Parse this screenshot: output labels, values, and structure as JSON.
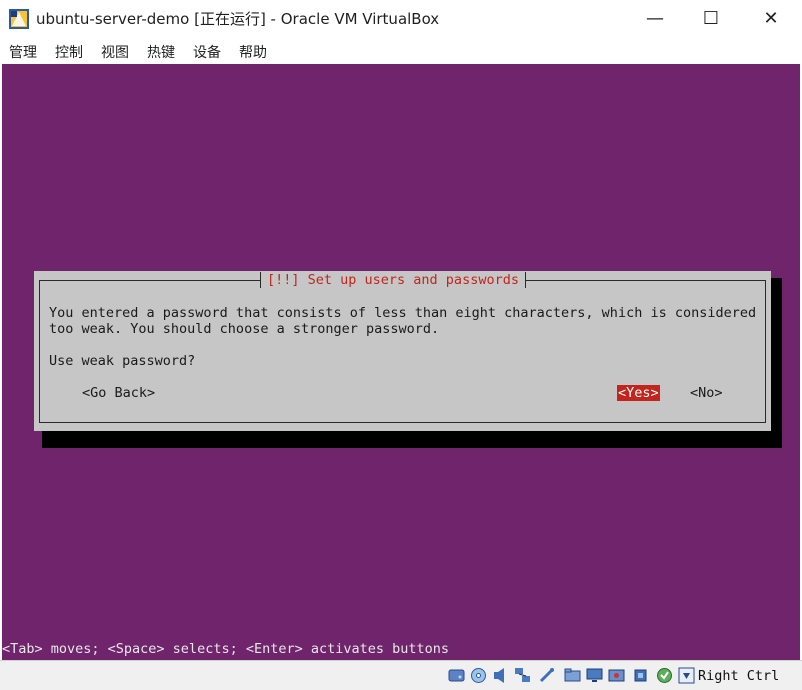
{
  "window": {
    "title": "ubuntu-server-demo [正在运行] - Oracle VM VirtualBox",
    "minimize_glyph": "—",
    "maximize_glyph": "☐",
    "close_glyph": "✕"
  },
  "menu": {
    "items": [
      "管理",
      "控制",
      "视图",
      "热键",
      "设备",
      "帮助"
    ]
  },
  "installer": {
    "dialog_title": "[!!] Set up users and passwords",
    "message_lines": [
      "You entered a password that consists of less than eight characters, which is considered",
      "too weak. You should choose a stronger password."
    ],
    "question": "Use weak password?",
    "buttons": {
      "go_back": "<Go Back>",
      "yes": "<Yes>",
      "no": "<No>"
    },
    "help_line": "<Tab> moves; <Space> selects; <Enter> activates buttons"
  },
  "statusbar": {
    "icons": [
      "hard-disk-icon",
      "optical-drive-icon",
      "audio-icon",
      "network-icon",
      "usb-icon",
      "shared-folder-icon",
      "display-icon",
      "video-capture-icon",
      "cpu-icon",
      "mouse-integration-icon",
      "host-key-arrow-icon"
    ],
    "host_key": "Right Ctrl"
  },
  "colors": {
    "vm_background": "#6f246c",
    "dialog_background": "#c6c6c6",
    "accent_red": "#c1251d"
  }
}
